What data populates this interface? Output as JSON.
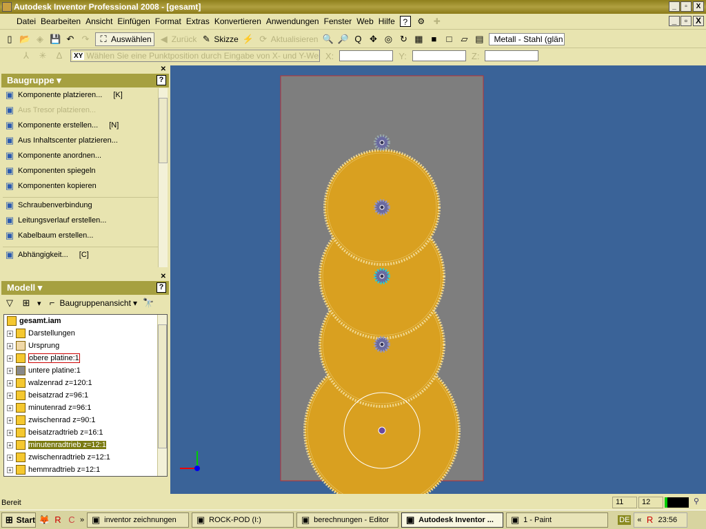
{
  "window": {
    "title": "Autodesk Inventor Professional 2008 - [gesamt]"
  },
  "menu": [
    "Datei",
    "Bearbeiten",
    "Ansicht",
    "Einfügen",
    "Format",
    "Extras",
    "Konvertieren",
    "Anwendungen",
    "Fenster",
    "Web",
    "Hilfe"
  ],
  "toolbar": {
    "select": "Auswählen",
    "back": "Zurück",
    "sketch": "Skizze",
    "update": "Aktualisieren",
    "material": "Metall - Stahl (glän"
  },
  "coord_bar": {
    "prompt": "Wählen Sie eine Punktposition durch Eingabe von X- und Y-Werten.",
    "x_label": "X:",
    "y_label": "Y:",
    "z_label": "Z:",
    "x": "",
    "y": "",
    "z": ""
  },
  "assembly_panel": {
    "title": "Baugruppe",
    "items": [
      {
        "label": "Komponente platzieren...",
        "shortcut": "[K]",
        "icon": "place-component-icon",
        "enabled": true
      },
      {
        "label": "Aus Tresor platzieren...",
        "shortcut": "",
        "icon": "vault-icon",
        "enabled": false
      },
      {
        "label": "Komponente erstellen...",
        "shortcut": "[N]",
        "icon": "create-component-icon",
        "enabled": true
      },
      {
        "label": "Aus Inhaltscenter platzieren...",
        "shortcut": "",
        "icon": "content-center-icon",
        "enabled": true
      },
      {
        "label": "Komponente anordnen...",
        "shortcut": "",
        "icon": "pattern-icon",
        "enabled": true
      },
      {
        "label": "Komponenten spiegeln",
        "shortcut": "",
        "icon": "mirror-icon",
        "enabled": true
      },
      {
        "label": "Komponenten kopieren",
        "shortcut": "",
        "icon": "copy-icon",
        "enabled": true
      },
      {
        "label": "Schraubenverbindung",
        "shortcut": "",
        "icon": "bolt-icon",
        "enabled": true
      },
      {
        "label": "Leitungsverlauf erstellen...",
        "shortcut": "",
        "icon": "tube-icon",
        "enabled": true
      },
      {
        "label": "Kabelbaum erstellen...",
        "shortcut": "",
        "icon": "harness-icon",
        "enabled": true
      },
      {
        "label": "Abhängigkeit...",
        "shortcut": "[C]",
        "icon": "constraint-icon",
        "enabled": true
      }
    ]
  },
  "model_panel": {
    "title": "Modell",
    "view": "Baugruppenansicht",
    "root": "gesamt.iam",
    "items": [
      {
        "label": "Darstellungen",
        "icon": "representations-icon"
      },
      {
        "label": "Ursprung",
        "icon": "folder-icon"
      },
      {
        "label": "obere platine:1",
        "icon": "part-icon",
        "state": "boxed"
      },
      {
        "label": "untere platine:1",
        "icon": "grey-part-icon"
      },
      {
        "label": "walzenrad z=120:1",
        "icon": "part-icon"
      },
      {
        "label": "beisatzrad z=96:1",
        "icon": "part-icon"
      },
      {
        "label": "minutenrad z=96:1",
        "icon": "part-icon"
      },
      {
        "label": "zwischenrad z=90:1",
        "icon": "part-icon"
      },
      {
        "label": "beisatzradtrieb z=16:1",
        "icon": "part-icon"
      },
      {
        "label": "minutenradtrieb z=12:1",
        "icon": "part-icon",
        "state": "selected"
      },
      {
        "label": "zwischenradtrieb z=12:1",
        "icon": "part-icon"
      },
      {
        "label": "hemmradtrieb z=12:1",
        "icon": "part-icon"
      }
    ]
  },
  "status": {
    "text": "Bereit",
    "n1": "11",
    "n2": "12"
  },
  "taskbar": {
    "start": "Start",
    "tasks": [
      "inventor zeichnungen",
      "ROCK-POD (I:)",
      "berechnungen - Editor",
      "Autodesk Inventor ...",
      "1 - Paint"
    ],
    "active": 3,
    "lang": "DE",
    "clock": "23:56"
  },
  "colors": {
    "viewport": "#3a6398",
    "gear": "#d9a020",
    "plate": "#7e7e7e"
  }
}
